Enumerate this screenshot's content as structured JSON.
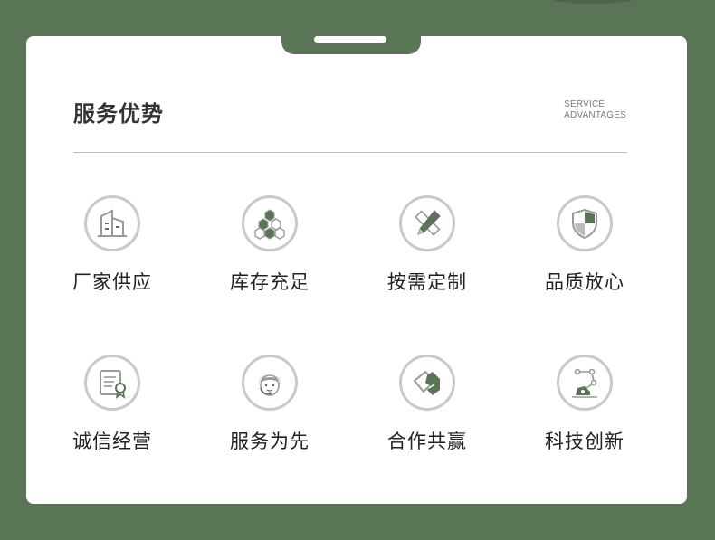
{
  "section": {
    "title": "服务优势",
    "subtitle_line1": "SERVICE",
    "subtitle_line2": "ADVANTAGES"
  },
  "features": [
    {
      "label": "厂家供应",
      "icon": "factory-building-icon"
    },
    {
      "label": "库存充足",
      "icon": "stacked-boxes-icon"
    },
    {
      "label": "按需定制",
      "icon": "pencil-ruler-icon"
    },
    {
      "label": "品质放心",
      "icon": "shield-icon"
    },
    {
      "label": "诚信经营",
      "icon": "certificate-icon"
    },
    {
      "label": "服务为先",
      "icon": "customer-service-icon"
    },
    {
      "label": "合作共赢",
      "icon": "handshake-icon"
    },
    {
      "label": "科技创新",
      "icon": "robot-arm-icon"
    }
  ],
  "colors": {
    "brand_green": "#5a7456",
    "icon_gray": "#c9c9c9",
    "text": "#222222"
  }
}
